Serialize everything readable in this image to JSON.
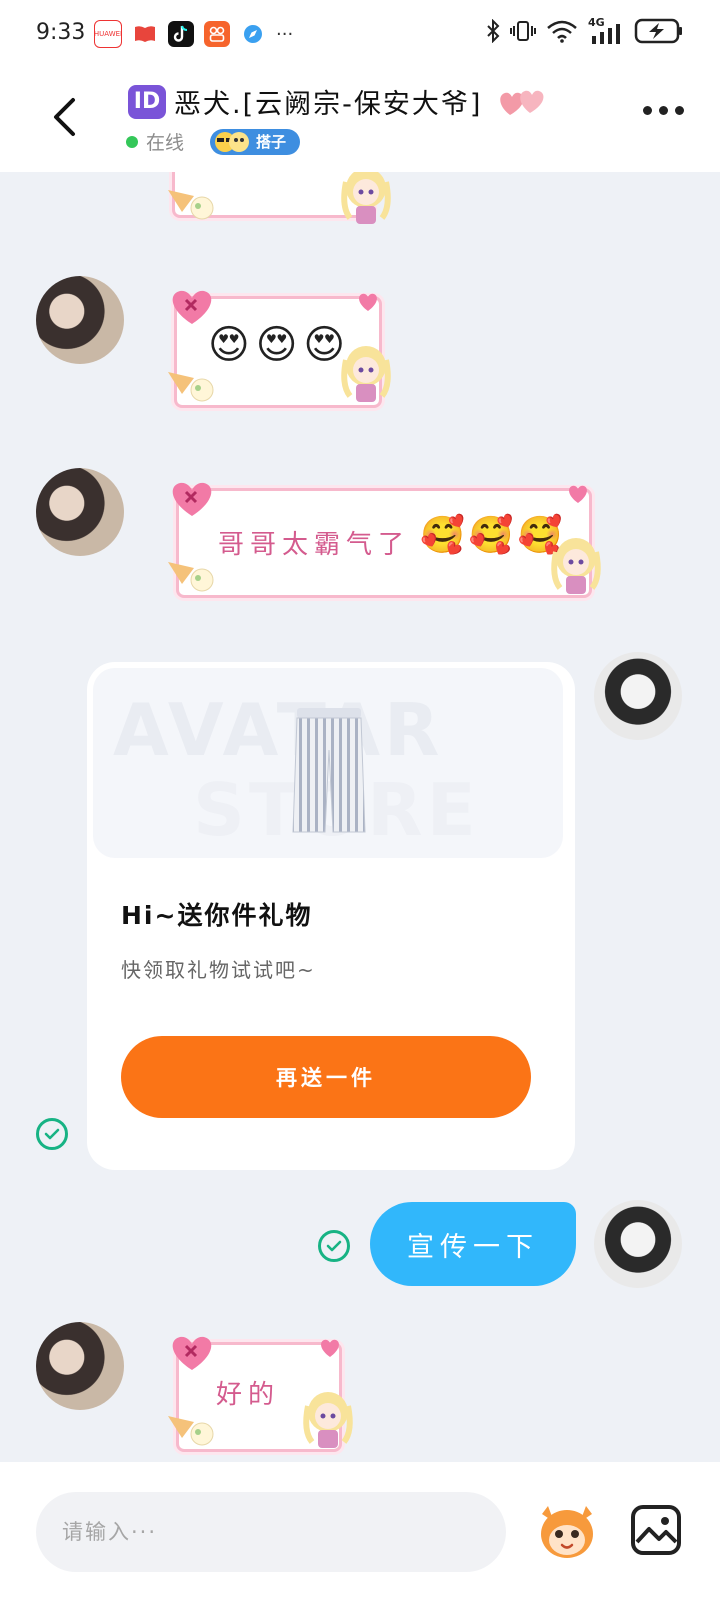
{
  "status_bar": {
    "time": "9:33",
    "network": "4G",
    "app_icons": [
      "huawei-store-icon",
      "book-icon",
      "tiktok-icon",
      "app-grid-icon",
      "compass-icon"
    ],
    "more": "···"
  },
  "header": {
    "id_badge": "ID",
    "title": "恶犬.[云阙宗-保安大爷]",
    "online_status": "在线",
    "tag": "搭子"
  },
  "messages": [
    {
      "type": "sticker-partial",
      "from": "other"
    },
    {
      "type": "sticker",
      "from": "other",
      "emojis": [
        "😍",
        "😍",
        "😍"
      ]
    },
    {
      "type": "sticker-text",
      "from": "other",
      "text": "哥哥太霸气了",
      "emojis": [
        "🥰",
        "🥰",
        "🥰"
      ]
    },
    {
      "type": "gift-card",
      "from": "self",
      "watermark_line1": "AVATAR",
      "watermark_line2": "STORE",
      "title": "Hi~送你件礼物",
      "subtitle": "快领取礼物试试吧~",
      "button": "再送一件"
    },
    {
      "type": "text",
      "from": "self",
      "text": "宣传一下"
    },
    {
      "type": "sticker-text",
      "from": "other",
      "text": "好的"
    }
  ],
  "input": {
    "placeholder": "请输入···"
  },
  "colors": {
    "accent_orange": "#fb7416",
    "bubble_blue": "#31b7fb",
    "online_green": "#34c759",
    "check_green": "#17b384",
    "sticker_border": "#f7b9cc",
    "sticker_text": "#d45b8e"
  }
}
